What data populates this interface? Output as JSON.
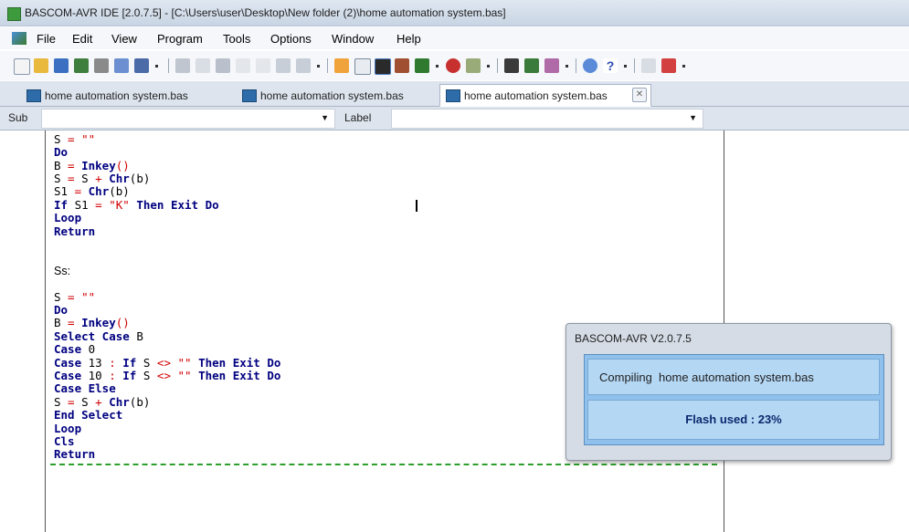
{
  "window": {
    "title": "BASCOM-AVR IDE [2.0.7.5] - [C:\\Users\\user\\Desktop\\New folder (2)\\home automation system.bas]"
  },
  "menu": [
    "File",
    "Edit",
    "View",
    "Program",
    "Tools",
    "Options",
    "Window",
    "Help"
  ],
  "tabs": [
    {
      "label": "home automation system.bas"
    },
    {
      "label": "home automation system.bas"
    },
    {
      "label": "home automation system.bas",
      "close": "✕"
    }
  ],
  "subbar": {
    "sub_label": "Sub",
    "label_label": "Label",
    "sub_value": "",
    "label_value": ""
  },
  "code": {
    "l1": {
      "a": "S",
      "b": " = ",
      "c": "\"\""
    },
    "l2": "Do",
    "l3": {
      "a": "B",
      "b": " = ",
      "c": "Inkey",
      "d": "()"
    },
    "l4": {
      "a": "S",
      "b": " = ",
      "c": "S",
      "d": " + ",
      "e": "Chr",
      "f": "(b)"
    },
    "l5": {
      "a": "S1",
      "b": " = ",
      "c": "Chr",
      "d": "(b)"
    },
    "l6": {
      "a": "If",
      "b": " S1",
      "c": " = ",
      "d": "\"K\"",
      "e": " Then Exit Do"
    },
    "l7": "Loop",
    "l8": "Return",
    "label_ss": "Ss:",
    "l9": {
      "a": "S",
      "b": " = ",
      "c": "\"\""
    },
    "l10": "Do",
    "l11": {
      "a": "B",
      "b": " = ",
      "c": "Inkey",
      "d": "()"
    },
    "l12": {
      "a": "Select Case",
      "b": " B"
    },
    "l13": {
      "a": "Case",
      "b": " 0"
    },
    "l14": {
      "a": "Case",
      "b": " 13",
      "c": " : ",
      "d": "If",
      "e": " S",
      "f": " <> ",
      "g": "\"\"",
      "h": " Then Exit Do"
    },
    "l15": {
      "a": "Case",
      "b": " 10",
      "c": " : ",
      "d": "If",
      "e": " S",
      "f": " <> ",
      "g": "\"\"",
      "h": " Then Exit Do"
    },
    "l16": "Case Else",
    "l17": {
      "a": "S",
      "b": " = ",
      "c": "S",
      "d": " + ",
      "e": "Chr",
      "f": "(b)"
    },
    "l18": "End Select",
    "l19": "Loop",
    "l20": "Cls",
    "l21": "Return"
  },
  "dialog": {
    "title": "BASCOM-AVR V2.0.7.5",
    "compiling": "Compiling  home automation system.bas",
    "flash": "Flash used : 23%"
  }
}
